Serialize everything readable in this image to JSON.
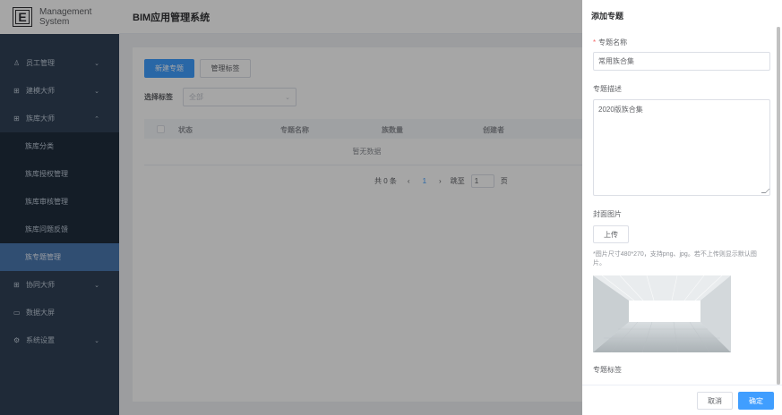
{
  "logo": {
    "badge": "E",
    "line1": "Management",
    "line2": "System"
  },
  "header": {
    "title": "BIM应用管理系统"
  },
  "sidebar": {
    "items": [
      {
        "icon": "user-icon",
        "glyph": "♙",
        "label": "员工管理",
        "chevron": "⌄"
      },
      {
        "icon": "grid-icon",
        "glyph": "⊞",
        "label": "建模大师",
        "chevron": "⌄"
      },
      {
        "icon": "grid-icon",
        "glyph": "⊞",
        "label": "族库大师",
        "chevron": "⌃"
      },
      {
        "icon": "grid-icon",
        "glyph": "⊞",
        "label": "协同大师",
        "chevron": "⌄"
      },
      {
        "icon": "monitor-icon",
        "glyph": "▭",
        "label": "数据大屏",
        "chevron": ""
      },
      {
        "icon": "gear-icon",
        "glyph": "⚙",
        "label": "系统设置",
        "chevron": "⌄"
      }
    ],
    "submenu": [
      "族库分类",
      "族库授权管理",
      "族库审核管理",
      "族库问题反馈",
      "族专题管理"
    ]
  },
  "main": {
    "new_button": "新建专题",
    "manage_tags_button": "管理标签",
    "filter_label": "选择标签",
    "filter_value": "全部",
    "table_columns": [
      "状态",
      "专题名称",
      "族数量",
      "创建者"
    ],
    "empty_text": "暂无数据",
    "pager": {
      "total": "共 0 条",
      "prev": "‹",
      "page": "1",
      "next": "›",
      "goto": "跳至",
      "goto_value": "1",
      "unit": "页"
    }
  },
  "drawer": {
    "title": "添加专题",
    "name_label": "专题名称",
    "name_required": "*",
    "name_value": "常用族合集",
    "desc_label": "专题描述",
    "desc_value": "2020版族合集",
    "cover_label": "封面图片",
    "upload_button": "上传",
    "upload_hint": "*图片尺寸480*270，支持png、jpg。若不上传则显示默认图片。",
    "tags_label": "专题标签",
    "cancel_button": "取消",
    "confirm_button": "确定"
  },
  "colors": {
    "primary": "#409eff",
    "sidebar_bg": "#304156",
    "active_item": "#4a78b0"
  }
}
